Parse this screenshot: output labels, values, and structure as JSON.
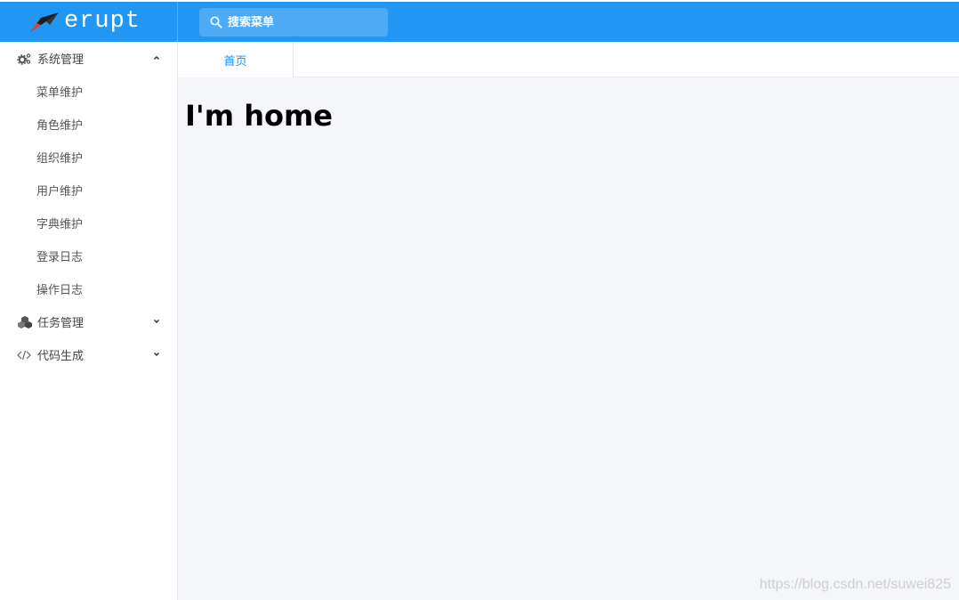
{
  "app": {
    "logo_text": "erupt",
    "brand_color": "#2196f3",
    "logo_icon": "bird-logo-icon"
  },
  "search": {
    "placeholder": "搜索菜单",
    "icon": "search-icon"
  },
  "sidebar": {
    "groups": [
      {
        "label": "系统管理",
        "icon": "gears-icon",
        "expanded": true,
        "items": [
          {
            "label": "菜单维护"
          },
          {
            "label": "角色维护"
          },
          {
            "label": "组织维护"
          },
          {
            "label": "用户维护"
          },
          {
            "label": "字典维护"
          },
          {
            "label": "登录日志"
          },
          {
            "label": "操作日志"
          }
        ]
      },
      {
        "label": "任务管理",
        "icon": "cubes-icon",
        "expanded": false,
        "items": []
      },
      {
        "label": "代码生成",
        "icon": "code-icon",
        "expanded": false,
        "items": []
      }
    ]
  },
  "tabs": [
    {
      "label": "首页",
      "active": true
    }
  ],
  "main": {
    "heading": "I'm home"
  },
  "watermark": "https://blog.csdn.net/suwei825"
}
